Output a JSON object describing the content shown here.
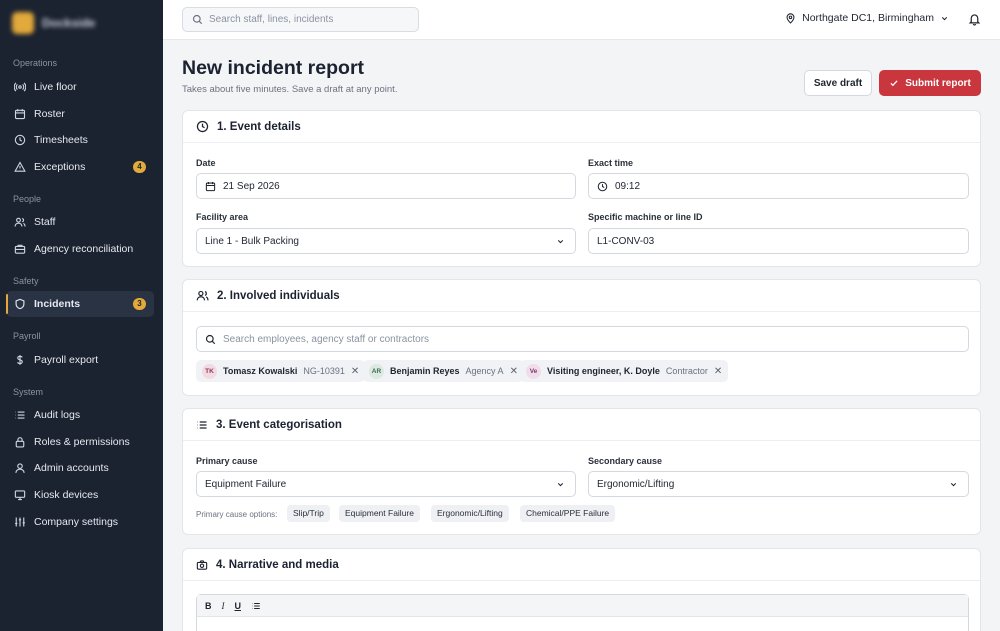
{
  "brand": {
    "name": "Dockside"
  },
  "sidebar": {
    "sections": [
      {
        "label": "Operations",
        "items": [
          {
            "label": "Live floor",
            "icon": "broadcast-icon"
          },
          {
            "label": "Roster",
            "icon": "calendar-icon"
          },
          {
            "label": "Timesheets",
            "icon": "clock-icon"
          },
          {
            "label": "Exceptions",
            "icon": "warning-icon",
            "badge": "4"
          }
        ]
      },
      {
        "label": "People",
        "items": [
          {
            "label": "Staff",
            "icon": "users-icon"
          },
          {
            "label": "Agency reconciliation",
            "icon": "briefcase-icon"
          }
        ]
      },
      {
        "label": "Safety",
        "items": [
          {
            "label": "Incidents",
            "icon": "shield-icon",
            "badge": "3",
            "active": true
          }
        ]
      },
      {
        "label": "Payroll",
        "items": [
          {
            "label": "Payroll export",
            "icon": "dollar-icon"
          }
        ]
      },
      {
        "label": "System",
        "items": [
          {
            "label": "Audit logs",
            "icon": "list-icon"
          },
          {
            "label": "Roles & permissions",
            "icon": "lock-icon"
          },
          {
            "label": "Admin accounts",
            "icon": "user-icon"
          },
          {
            "label": "Kiosk devices",
            "icon": "monitor-icon"
          },
          {
            "label": "Company settings",
            "icon": "sliders-icon"
          }
        ]
      }
    ]
  },
  "topbar": {
    "search_placeholder": "Search staff, lines, incidents",
    "facility": "Northgate DC1, Birmingham"
  },
  "page": {
    "title": "New incident report",
    "subtitle": "Takes about five minutes. Save a draft at any point.",
    "save_draft": "Save draft",
    "submit": "Submit report"
  },
  "event_details": {
    "title": "1. Event details",
    "date_label": "Date",
    "date_value": "21 Sep 2026",
    "time_label": "Exact time",
    "time_value": "09:12",
    "area_label": "Facility area",
    "area_value": "Line 1 - Bulk Packing",
    "machine_label": "Specific machine or line ID",
    "machine_value": "L1-CONV-03"
  },
  "individuals": {
    "title": "2. Involved individuals",
    "search_placeholder": "Search employees, agency staff or contractors",
    "people": [
      {
        "initials": "TK",
        "name": "Tomasz Kowalski",
        "meta": "NG-10391",
        "color": "#f3d9e2",
        "text": "#8a3b55"
      },
      {
        "initials": "AR",
        "name": "Benjamin Reyes",
        "meta": "Agency A",
        "color": "#dbe9e1",
        "text": "#3d6b52"
      },
      {
        "initials": "Ve",
        "name": "Visiting engineer, K. Doyle",
        "meta": "Contractor",
        "color": "#f1dcea",
        "text": "#7c3a6c"
      }
    ]
  },
  "categorisation": {
    "title": "3. Event categorisation",
    "primary_label": "Primary cause",
    "primary_value": "Equipment Failure",
    "secondary_label": "Secondary cause",
    "secondary_value": "Ergonomic/Lifting",
    "options_label": "Primary cause options:",
    "options": [
      "Slip/Trip",
      "Equipment Failure",
      "Ergonomic/Lifting",
      "Chemical/PPE Failure"
    ]
  },
  "narrative": {
    "title": "4. Narrative and media",
    "toolbar": {
      "bold": "B",
      "italic": "I",
      "underline": "U"
    }
  },
  "colors": {
    "sidebar_bg": "#1b2230",
    "accent": "#e2a93b",
    "danger": "#c9363e"
  }
}
